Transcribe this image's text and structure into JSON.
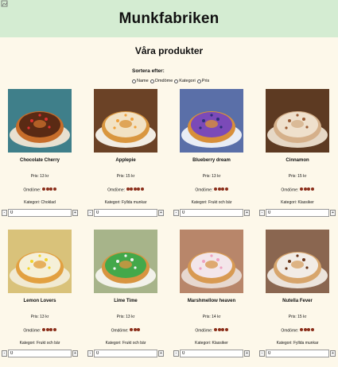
{
  "header": {
    "title": "Munkfabriken"
  },
  "section": {
    "title": "Våra produkter"
  },
  "sort": {
    "label": "Sortera efter:",
    "options": [
      "Name",
      "Omdöme",
      "Kategori",
      "Pris"
    ]
  },
  "products": [
    {
      "name": "Chocolate Cherry",
      "price": "Pris: 13 kr",
      "rating_label": "Omdöme:",
      "rating": 4,
      "category": "Kategori: Choklad",
      "qty": "0"
    },
    {
      "name": "Applepie",
      "price": "Pris: 15 kr",
      "rating_label": "Omdöme:",
      "rating": 5,
      "category": "Kategori: Fyllda munkar",
      "qty": "0"
    },
    {
      "name": "Blueberry dream",
      "price": "Pris: 13 kr",
      "rating_label": "Omdöme:",
      "rating": 4,
      "category": "Kategori: Frukt och bär",
      "qty": "0"
    },
    {
      "name": "Cinnamon",
      "price": "Pris: 15 kr",
      "rating_label": "Omdöme:",
      "rating": 4,
      "category": "Kategori: Klassiker",
      "qty": "0"
    },
    {
      "name": "Lemon Lovers",
      "price": "Pris: 13 kr",
      "rating_label": "Omdöme:",
      "rating": 4,
      "category": "Kategori: Frukt och bär",
      "qty": "0"
    },
    {
      "name": "Lime Time",
      "price": "Pris: 13 kr",
      "rating_label": "Omdöme:",
      "rating": 3,
      "category": "Kategori: Frukt och bär",
      "qty": "0"
    },
    {
      "name": "Marshmellow heaven",
      "price": "Pris: 14 kr",
      "rating_label": "Omdöme:",
      "rating": 4,
      "category": "Kategori: Klassiker",
      "qty": "0"
    },
    {
      "name": "Nutella Fever",
      "price": "Pris: 15 kr",
      "rating_label": "Omdöme:",
      "rating": 4,
      "category": "Kategori: Fyllda munkar",
      "qty": "0"
    }
  ],
  "stepper": {
    "minus": "-",
    "plus": "+"
  },
  "colors": {
    "header_bg": "#d4ecd2",
    "page_bg": "#fdf8ea",
    "rating_dot": "#8b2e1a"
  },
  "images": [
    {
      "icon": "chocolate-cherry-donut-image",
      "bg": "#3f7f8a",
      "ring": "#c76d2a",
      "glaze": "#5a2a14",
      "top": "#e03030",
      "plate": "#e8e0d0"
    },
    {
      "icon": "applepie-donut-image",
      "bg": "#6b4226",
      "ring": "#d9963f",
      "glaze": "#f2e2c4",
      "top": "#f0a03a",
      "plate": "#f2ede4"
    },
    {
      "icon": "blueberry-donut-image",
      "bg": "#5a6fa8",
      "ring": "#d88f3a",
      "glaze": "#7b4ab8",
      "top": "#2a2f7a",
      "plate": "#e9edf5"
    },
    {
      "icon": "cinnamon-donut-image",
      "bg": "#5d3a22",
      "ring": "#d5b08a",
      "glaze": "#efe0cc",
      "top": "#9a5a32",
      "plate": "#e6d8c6"
    },
    {
      "icon": "lemon-donut-image",
      "bg": "#d9c27a",
      "ring": "#e2a040",
      "glaze": "#f5f0d8",
      "top": "#f2d32a",
      "plate": "#f1ead2"
    },
    {
      "icon": "lime-donut-image",
      "bg": "#a7b48a",
      "ring": "#d89440",
      "glaze": "#43a84a",
      "top": "#f4f4f4",
      "plate": "#f2f2ea"
    },
    {
      "icon": "marshmallow-donut-image",
      "bg": "#b8866a",
      "ring": "#d89a52",
      "glaze": "#f3e6ea",
      "top": "#f0a0c0",
      "plate": "#e7d8cf"
    },
    {
      "icon": "nutella-donut-image",
      "bg": "#8a6650",
      "ring": "#d7a56c",
      "glaze": "#f2ece6",
      "top": "#6a3418",
      "plate": "#ece4dc"
    }
  ]
}
